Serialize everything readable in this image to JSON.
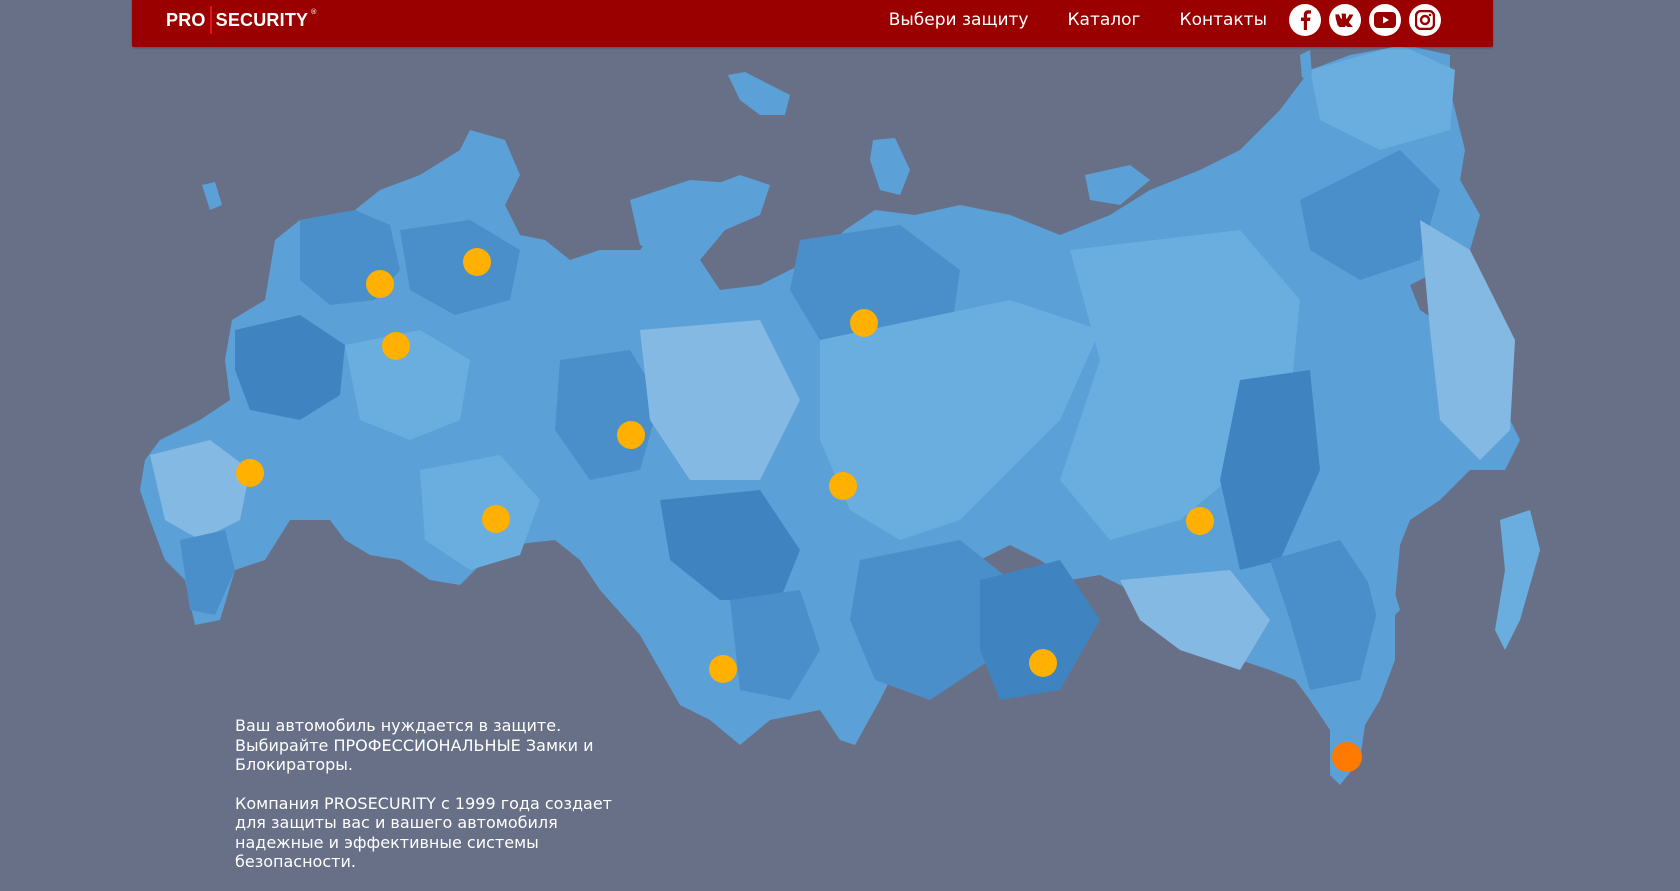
{
  "header": {
    "logo_left": "PRO",
    "logo_right": "SECURITY",
    "logo_mark": "®",
    "brand_color": "#9b0001",
    "nav": [
      {
        "label": "Выбери защиту"
      },
      {
        "label": "Каталог"
      },
      {
        "label": "Контакты"
      }
    ],
    "social": [
      {
        "icon": "facebook-icon"
      },
      {
        "icon": "vk-icon"
      },
      {
        "icon": "youtube-icon"
      },
      {
        "icon": "instagram-icon"
      }
    ]
  },
  "map": {
    "background_color": "#687088",
    "region_colors": [
      "#5ba1d7",
      "#4a8fca",
      "#6aaedf",
      "#84b9e3",
      "#3f84c0"
    ],
    "marker_color": "#ffb000",
    "active_marker_color": "#ff7a00"
  },
  "intro": {
    "paragraph1": "Ваш автомобиль нуждается в защите. Выбирайте ПРОФЕССИОНАЛЬНЫЕ Замки и Блокираторы.",
    "paragraph2": "Компания PROSECURITY с 1999 года создает для защиты вас и вашего автомобиля надежные и эффективные системы безопасности."
  }
}
